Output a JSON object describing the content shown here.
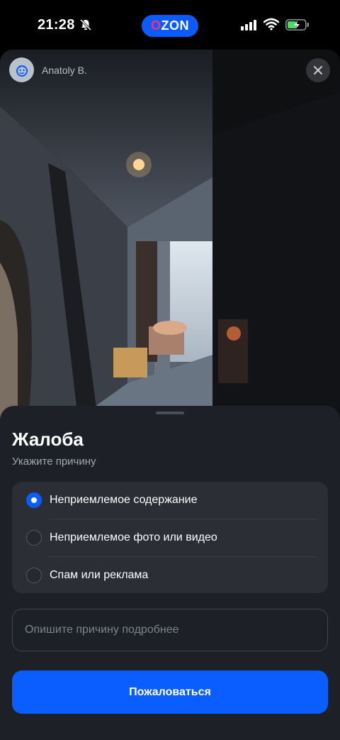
{
  "status_bar": {
    "time": "21:28",
    "app_badge": "OZON"
  },
  "viewer": {
    "author_name": "Anatoly B."
  },
  "complaint_sheet": {
    "title": "Жалоба",
    "subtitle": "Укажите причину",
    "options": [
      {
        "label": "Неприемлемое содержание",
        "selected": true
      },
      {
        "label": "Неприемлемое фото или видео",
        "selected": false
      },
      {
        "label": "Спам или реклама",
        "selected": false
      }
    ],
    "details_placeholder": "Опишите причину подробнее",
    "submit_label": "Пожаловаться"
  },
  "colors": {
    "accent": "#0a5dff",
    "sheet_bg": "#1d2026",
    "options_bg": "#2b2e35"
  }
}
